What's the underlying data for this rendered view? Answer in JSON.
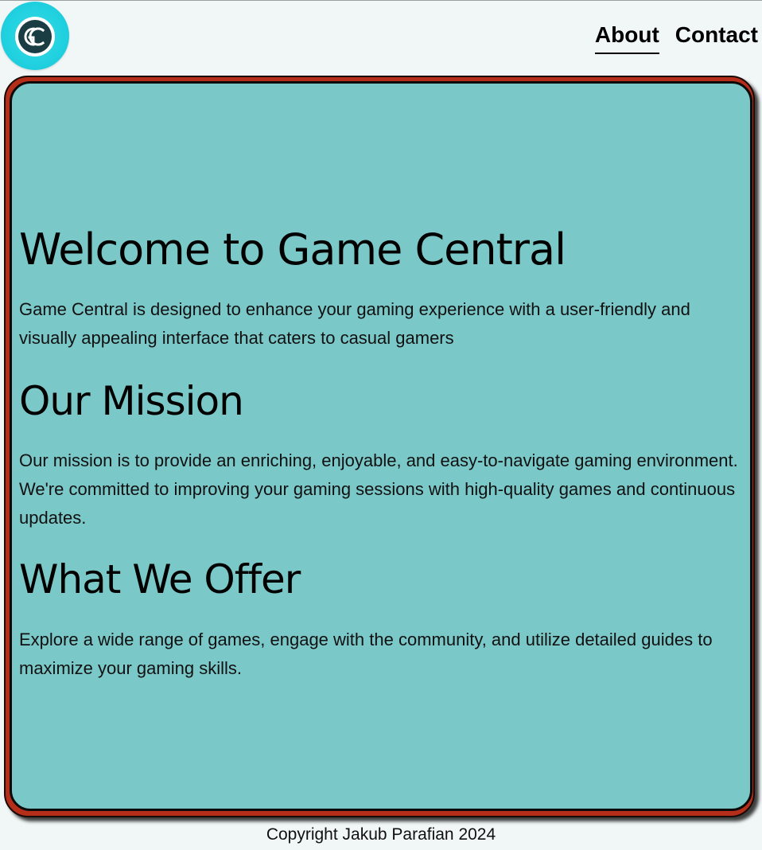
{
  "logo": {
    "text": "GC",
    "colors": {
      "outer": "#22d2e0",
      "ring": "#ffffff",
      "inner": "#1a3d44"
    }
  },
  "nav": {
    "items": [
      {
        "label": "About",
        "active": true
      },
      {
        "label": "Contact",
        "active": false
      }
    ]
  },
  "colors": {
    "page_background": "#f1f6f6",
    "card_border": "#b52e1a",
    "card_background": "#7bc8c9"
  },
  "main": {
    "welcome_title": "Welcome to Game Central",
    "welcome_text": "Game Central is designed to enhance your gaming experience with a user-friendly and visually appealing interface that caters to casual gamers",
    "mission_title": "Our Mission",
    "mission_text": "Our mission is to provide an enriching, enjoyable, and easy-to-navigate gaming environment. We're committed to improving your gaming sessions with high-quality games and continuous updates.",
    "offer_title": "What We Offer",
    "offer_text": "Explore a wide range of games, engage with the community, and utilize detailed guides to maximize your gaming skills."
  },
  "footer": {
    "copyright": "Copyright Jakub Parafian 2024"
  }
}
